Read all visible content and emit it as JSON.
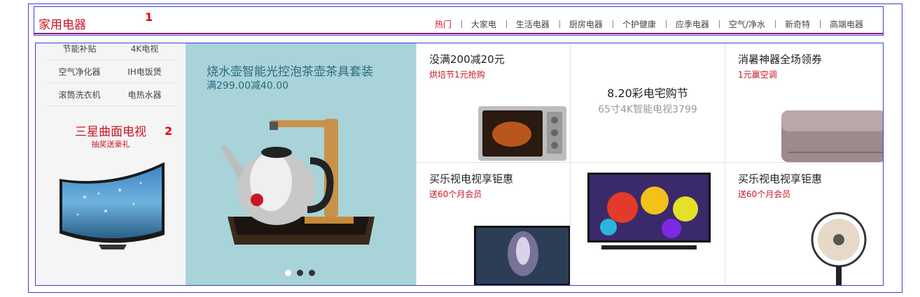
{
  "header": {
    "title": "家用电器",
    "annotation": "1",
    "tabs": [
      {
        "label": "热门",
        "active": true
      },
      {
        "label": "大家电"
      },
      {
        "label": "生活电器"
      },
      {
        "label": "厨房电器"
      },
      {
        "label": "个护健康"
      },
      {
        "label": "应季电器"
      },
      {
        "label": "空气/净水"
      },
      {
        "label": "新奇特"
      },
      {
        "label": "高端电器"
      }
    ]
  },
  "left": {
    "links": [
      [
        "节能补贴",
        "4K电视"
      ],
      [
        "空气净化器",
        "IH电饭煲"
      ],
      [
        "滚筒洗衣机",
        "电热水器"
      ]
    ],
    "promo_title": "三星曲面电视",
    "promo_sub": "抽奖送豪礼",
    "annotation": "2"
  },
  "carousel": {
    "title": "烧水壶智能光控泡茶壶茶具套装",
    "subtitle": "满299.00减40.00",
    "dots": 3,
    "active_dot": 0
  },
  "tiles": {
    "oven": {
      "title": "没满200减20元",
      "sub": "烘培节1元抢购"
    },
    "center": {
      "title": "8.20彩电宅购节",
      "sub": "65寸4K智能电视3799"
    },
    "ac": {
      "title": "消暑神器全场领券",
      "sub": "1元赢空调"
    },
    "tv1": {
      "title": "买乐视电视享钜惠",
      "sub": "送60个月会员"
    },
    "fan": {
      "title": "买乐视电视享钜惠",
      "sub": "送60个月会员"
    }
  },
  "colors": {
    "accent": "#c81623",
    "annotation_border": "#3b3fd6",
    "carousel_bg": "#a8d3d8"
  }
}
